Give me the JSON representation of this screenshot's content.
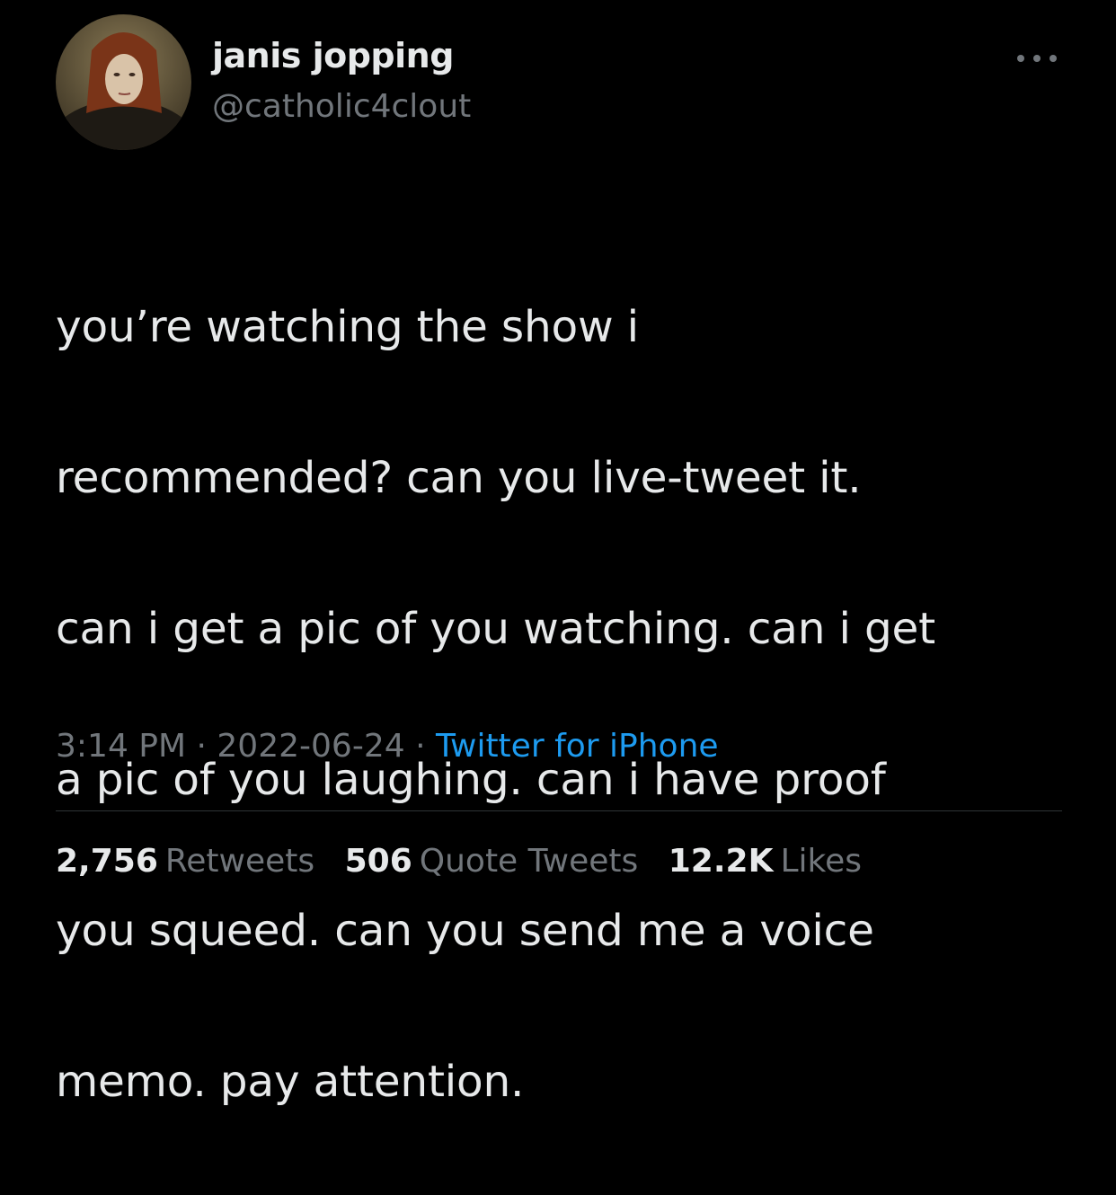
{
  "author": {
    "display_name": "janis jopping",
    "handle": "@catholic4clout",
    "avatar_icon": "profile-photo"
  },
  "more_icon": "more-horizontal-icon",
  "tweet": {
    "text_lines": [
      "you’re watching the show i",
      "recommended? can you live-tweet it.",
      "can i get a pic of you watching. can i get",
      "a pic of you laughing. can i have proof",
      "you squeed. can you send me a voice",
      "memo. pay attention."
    ]
  },
  "meta": {
    "time": "3:14 PM",
    "separator": " · ",
    "date": "2022-06-24",
    "source": "Twitter for iPhone"
  },
  "stats": {
    "retweets_count": "2,756",
    "retweets_label": "Retweets",
    "quotes_count": "506",
    "quotes_label": "Quote Tweets",
    "likes_count": "12.2K",
    "likes_label": "Likes"
  },
  "colors": {
    "background": "#000000",
    "text_primary": "#e7e9ea",
    "text_secondary": "#71767b",
    "link": "#1d9bf0",
    "divider": "#2f3336"
  }
}
